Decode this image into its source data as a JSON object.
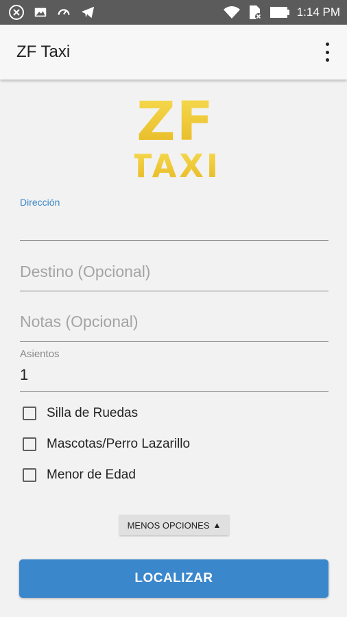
{
  "status_bar": {
    "time": "1:14 PM"
  },
  "app_bar": {
    "title": "ZF Taxi"
  },
  "logo": {
    "line1": "ZF",
    "line2": "TAXI"
  },
  "form": {
    "direccion_label": "Dirección",
    "destino_placeholder": "Destino (Opcional)",
    "notas_placeholder": "Notas (Opcional)",
    "asientos_label": "Asientos",
    "asientos_value": "1",
    "checkboxes": [
      {
        "label": "Silla de Ruedas",
        "checked": false
      },
      {
        "label": "Mascotas/Perro Lazarillo",
        "checked": false
      },
      {
        "label": "Menor de Edad",
        "checked": false
      }
    ],
    "less_options_label": "MENOS OPCIONES",
    "locate_label": "LOCALIZAR"
  },
  "colors": {
    "accent": "#3b87cc",
    "logo_yellow": "#f3cf2c",
    "status_bar": "#5b5b5b"
  }
}
